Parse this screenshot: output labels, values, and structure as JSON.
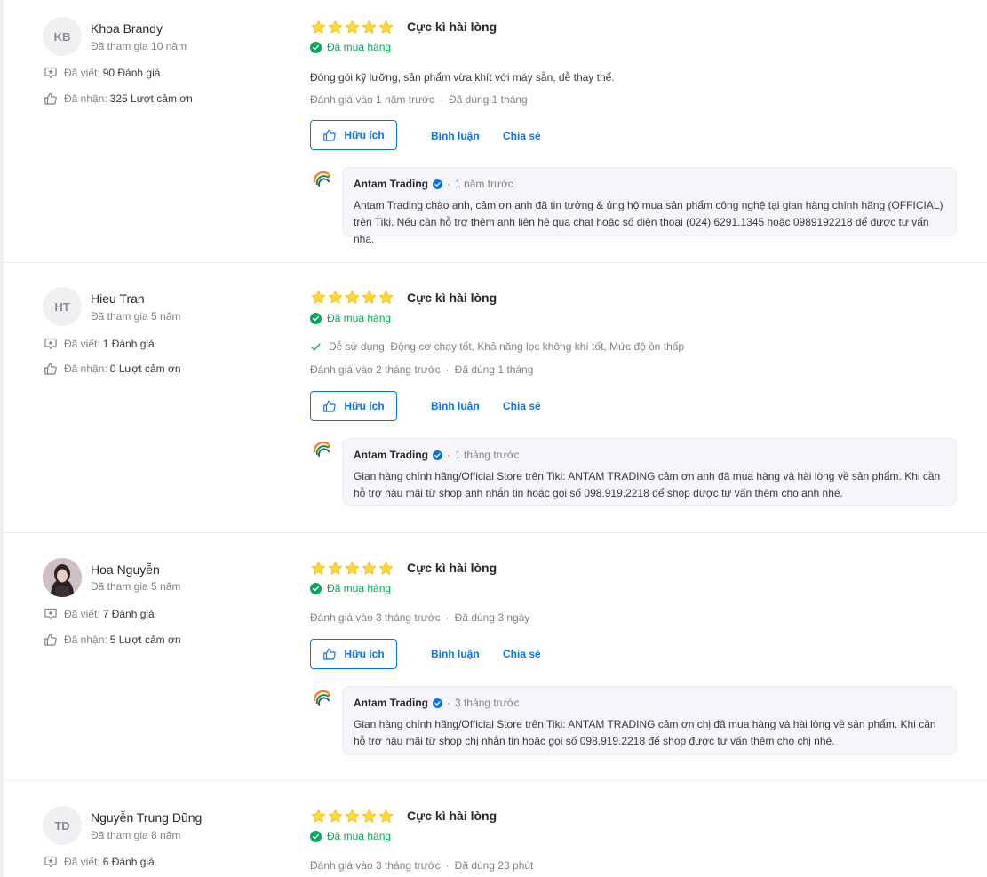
{
  "colors": {
    "accent": "#0b74e5",
    "star": "#fdd836",
    "verified": "#00ab56",
    "muted": "#808089"
  },
  "labels": {
    "written_label": "Đã viết:",
    "received_label": "Đã nhận:",
    "helpful": "Hữu ích",
    "comment": "Bình luận",
    "share": "Chia sẻ",
    "verified": "Đã mua hàng"
  },
  "reviews": [
    {
      "initials": "KB",
      "name": "Khoa Brandy",
      "joined": "Đã tham gia 10 năm",
      "written": "90 Đánh giá",
      "thanks": "325 Lượt cảm ơn",
      "stars": 5,
      "rating_title": "Cực kì hài lòng",
      "content": "Đóng gói kỹ lưỡng, sản phẩm vừa khít với máy sẵn, dễ thay thế.",
      "reviewed_at": "Đánh giá vào 1 năm trước",
      "used_for": "Đã dùng 1 tháng",
      "reply": {
        "shop": "Antam Trading",
        "time": "1 năm trước",
        "text": "Antam Trading chào anh, cảm ơn anh đã tin tưởng & ủng hộ mua sản phẩm công nghệ tại gian hàng chính hãng (OFFICIAL) trên Tiki. Nếu cần hỗ trợ thêm anh liên hệ qua chat hoặc số điện thoại (024) 6291.1345 hoặc 0989192218 để được tư vấn nha."
      }
    },
    {
      "initials": "HT",
      "name": "Hieu Tran",
      "joined": "Đã tham gia 5 năm",
      "written": "1 Đánh giá",
      "thanks": "0 Lượt cảm ơn",
      "stars": 5,
      "rating_title": "Cực kì hài lòng",
      "attributes": "Dễ sử dụng, Động cơ chạy tốt, Khả năng lọc không khí tốt, Mức độ ồn thấp",
      "reviewed_at": "Đánh giá vào 2 tháng trước",
      "used_for": "Đã dùng 1 tháng",
      "reply": {
        "shop": "Antam Trading",
        "time": "1 tháng trước",
        "text": "Gian hàng chính hãng/Official Store trên Tiki: ANTAM TRADING cảm ơn anh đã mua hàng và hài lòng về sản phẩm. Khi cần hỗ trợ hậu mãi từ shop anh nhắn tin hoặc gọi số 098.919.2218 để shop được tư vấn thêm cho anh nhé."
      }
    },
    {
      "initials": "",
      "name": "Hoa Nguyễn",
      "joined": "Đã tham gia 5 năm",
      "written": "7 Đánh giá",
      "thanks": "5 Lượt cảm ơn",
      "stars": 5,
      "rating_title": "Cực kì hài lòng",
      "reviewed_at": "Đánh giá vào 3 tháng trước",
      "used_for": "Đã dùng 3 ngày",
      "reply": {
        "shop": "Antam Trading",
        "time": "3 tháng trước",
        "text": "Gian hàng chính hãng/Official Store trên Tiki: ANTAM TRADING cảm ơn chị đã mua hàng và hài lòng về sản phẩm. Khi cần hỗ trợ hậu mãi từ shop chị nhắn tin hoặc gọi số 098.919.2218 để shop được tư vấn thêm cho chị nhé."
      }
    },
    {
      "initials": "TD",
      "name": "Nguyễn Trung Dũng",
      "joined": "Đã tham gia 8 năm",
      "written": "6 Đánh giá",
      "stars": 5,
      "rating_title": "Cực kì hài lòng",
      "reviewed_at": "Đánh giá vào 3 tháng trước",
      "used_for": "Đã dùng 23 phút"
    }
  ]
}
